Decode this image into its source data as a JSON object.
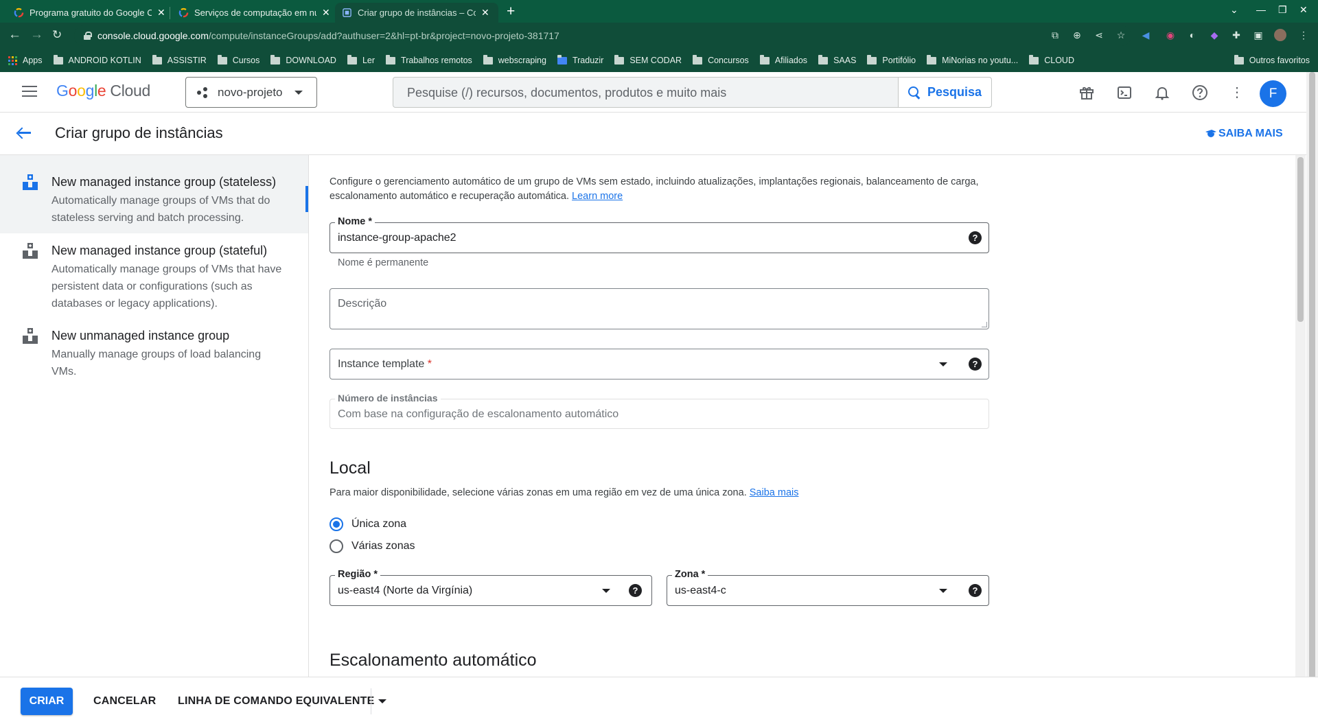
{
  "browser": {
    "tabs": [
      {
        "title": "Programa gratuito do Google C",
        "active": false
      },
      {
        "title": "Serviços de computação em nu",
        "active": false
      },
      {
        "title": "Criar grupo de instâncias – Con",
        "active": true
      }
    ],
    "url_host": "console.cloud.google.com",
    "url_path": "/compute/instanceGroups/add?authuser=2&hl=pt-br&project=novo-projeto-381717",
    "bookmarks": [
      "Apps",
      "ANDROID KOTLIN",
      "ASSISTIR",
      "Cursos",
      "DOWNLOAD",
      "Ler",
      "Trabalhos remotos",
      "webscraping",
      "Traduzir",
      "SEM CODAR",
      "Concursos",
      "Afiliados",
      "SAAS",
      "Portifólio",
      "MiNorias no youtu...",
      "CLOUD"
    ],
    "other_bookmarks": "Outros favoritos"
  },
  "header": {
    "logo_google": [
      "G",
      "o",
      "o",
      "g",
      "l",
      "e"
    ],
    "logo_cloud": "Cloud",
    "project": "novo-projeto",
    "search_placeholder": "Pesquise (/) recursos, documentos, produtos e muito mais",
    "search_button": "Pesquisa",
    "avatar_letter": "F"
  },
  "page": {
    "title": "Criar grupo de instâncias",
    "learn_more": "SAIBA MAIS"
  },
  "options": [
    {
      "title": "New managed instance group (stateless)",
      "description": "Automatically manage groups of VMs that do stateless serving and batch processing.",
      "selected": true
    },
    {
      "title": "New managed instance group (stateful)",
      "description": "Automatically manage groups of VMs that have persistent data or configurations (such as databases or legacy applications).",
      "selected": false
    },
    {
      "title": "New unmanaged instance group",
      "description": "Manually manage groups of load balancing VMs.",
      "selected": false
    }
  ],
  "form": {
    "intro": "Configure o gerenciamento automático de um grupo de VMs sem estado, incluindo atualizações, implantações regionais, balanceamento de carga, escalonamento automático e recuperação automática.",
    "intro_link": "Learn more",
    "name_label": "Nome *",
    "name_value": "instance-group-apache2",
    "name_hint": "Nome é permanente",
    "description_placeholder": "Descrição",
    "template_placeholder": "Instance template",
    "template_required": "*",
    "instances_label": "Número de instâncias",
    "instances_value": "Com base na configuração de escalonamento automático",
    "local_heading": "Local",
    "local_text": "Para maior disponibilidade, selecione várias zonas em uma região em vez de uma única zona.",
    "local_link": "Saiba mais",
    "zone_options": [
      {
        "label": "Única zona",
        "checked": true
      },
      {
        "label": "Várias zonas",
        "checked": false
      }
    ],
    "region_label": "Região *",
    "region_value": "us-east4 (Norte da Virgínia)",
    "zone_label": "Zona *",
    "zone_value": "us-east4-c",
    "autoscale_heading": "Escalonamento automático"
  },
  "footer": {
    "create": "CRIAR",
    "cancel": "CANCELAR",
    "cli": "LINHA DE COMANDO EQUIVALENTE"
  }
}
